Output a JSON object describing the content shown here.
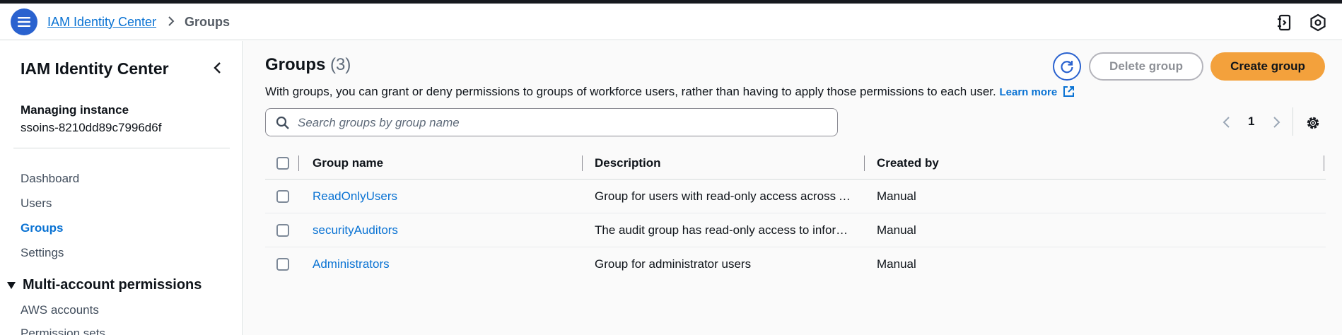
{
  "breadcrumb": {
    "root": "IAM Identity Center",
    "current": "Groups"
  },
  "sidebar": {
    "title": "IAM Identity Center",
    "managing_label": "Managing instance",
    "managing_value": "ssoins-8210dd89c7996d6f",
    "items": [
      {
        "label": "Dashboard",
        "active": false
      },
      {
        "label": "Users",
        "active": false
      },
      {
        "label": "Groups",
        "active": true
      },
      {
        "label": "Settings",
        "active": false
      }
    ],
    "section": {
      "label": "Multi-account permissions",
      "items": [
        {
          "label": "AWS accounts"
        },
        {
          "label": "Permission sets"
        }
      ]
    }
  },
  "main": {
    "title": "Groups",
    "count": "(3)",
    "description": "With groups, you can grant or deny permissions to groups of workforce users, rather than having to apply those permissions to each user.",
    "learn_more": "Learn more",
    "delete_label": "Delete group",
    "create_label": "Create group",
    "search_placeholder": "Search groups by group name",
    "page_number": "1"
  },
  "table": {
    "columns": [
      "Group name",
      "Description",
      "Created by"
    ],
    "rows": [
      {
        "name": "ReadOnlyUsers",
        "description": "Group for users with read-only access across AWS ac…",
        "created_by": "Manual"
      },
      {
        "name": "securityAuditors",
        "description": "The audit group has read-only access to information…",
        "created_by": "Manual"
      },
      {
        "name": "Administrators",
        "description": "Group for administrator users",
        "created_by": "Manual"
      }
    ]
  },
  "colors": {
    "accent": "#0972d3",
    "primary_button": "#f3a13c",
    "menu_button": "#2a62cf",
    "text": "#0f141a"
  },
  "icons": [
    "hamburger-menu-icon",
    "chevron-right-icon",
    "notifications-icon",
    "settings-icon",
    "chevron-left-icon",
    "refresh-icon",
    "external-link-icon",
    "search-icon",
    "gear-icon"
  ]
}
